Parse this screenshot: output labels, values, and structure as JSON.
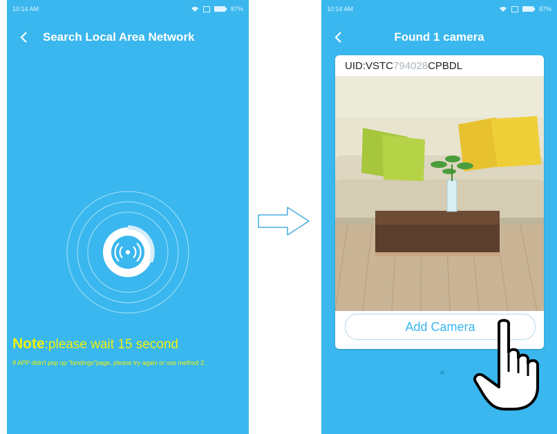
{
  "left_screen": {
    "status_time": "10:14 AM",
    "status_battery": "87%",
    "title": "Search Local Area Network",
    "note_label": "Note",
    "note_text": ":please wait 15 second",
    "hint": "If APP didn't pop up \"bindings\"page, please try again or use method 2."
  },
  "right_screen": {
    "status_time": "10:14 AM",
    "status_battery": "87%",
    "title": "Found 1 camera",
    "uid_prefix": "UID:VSTC",
    "uid_masked": "794028",
    "uid_suffix": "CPBDL",
    "add_button": "Add Camera"
  },
  "icons": [
    "back-chevron-icon",
    "wifi-icon",
    "battery-icon",
    "broadcast-icon",
    "arrow-right-icon",
    "pointing-hand-icon"
  ],
  "colors": {
    "screen_bg": "#3ab7ee",
    "note_yellow": "#f2f10a",
    "button_text": "#3ab7ee"
  }
}
